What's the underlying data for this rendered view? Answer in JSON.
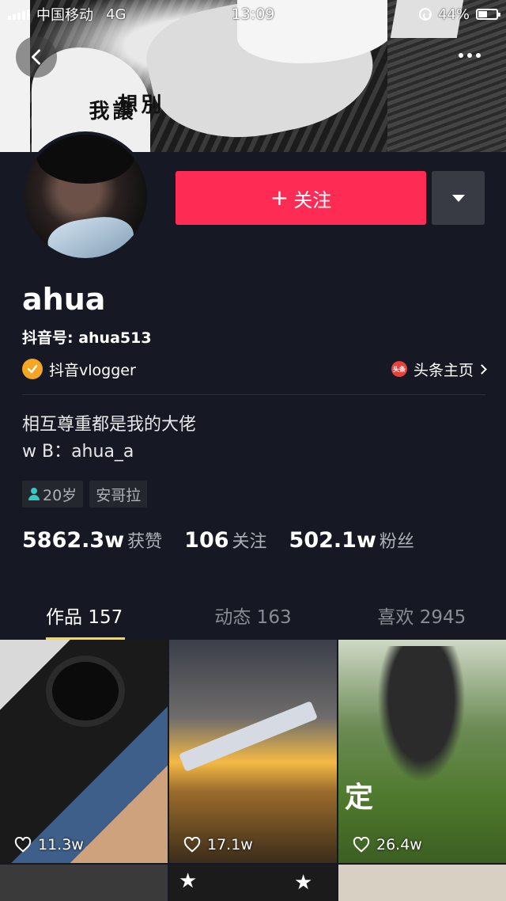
{
  "status_bar": {
    "carrier": "中国移动",
    "network": "4G",
    "time": "13:09",
    "battery": "44%"
  },
  "cover": {
    "text_col1": "別想",
    "text_col2": "讓我"
  },
  "profile": {
    "nickname": "ahua",
    "douyin_id": "抖音号: ahua513",
    "verification": "抖音vlogger",
    "toutiao_label": "头条主页",
    "toutiao_icon_text": "头条",
    "bio_line1": "相互尊重都是我的大佬",
    "bio_line2": "w B：ahua_a",
    "tags": {
      "age": "20岁",
      "location": "安哥拉"
    },
    "follow_button": "关注",
    "follow_plus": "+"
  },
  "stats": {
    "likes_num": "5862.3w",
    "likes_label": "获赞",
    "following_num": "106",
    "following_label": "关注",
    "followers_num": "502.1w",
    "followers_label": "粉丝"
  },
  "tabs": {
    "works": "作品 157",
    "activity": "动态 163",
    "liked": "喜欢 2945"
  },
  "videos": [
    {
      "likes": "11.3w"
    },
    {
      "likes": "17.1w"
    },
    {
      "likes": "26.4w",
      "overlay": "定"
    }
  ],
  "colors": {
    "background": "#161823",
    "accent": "#fe2c55",
    "tab_indicator": "#fcd83f",
    "verify_badge": "#f5a623"
  }
}
